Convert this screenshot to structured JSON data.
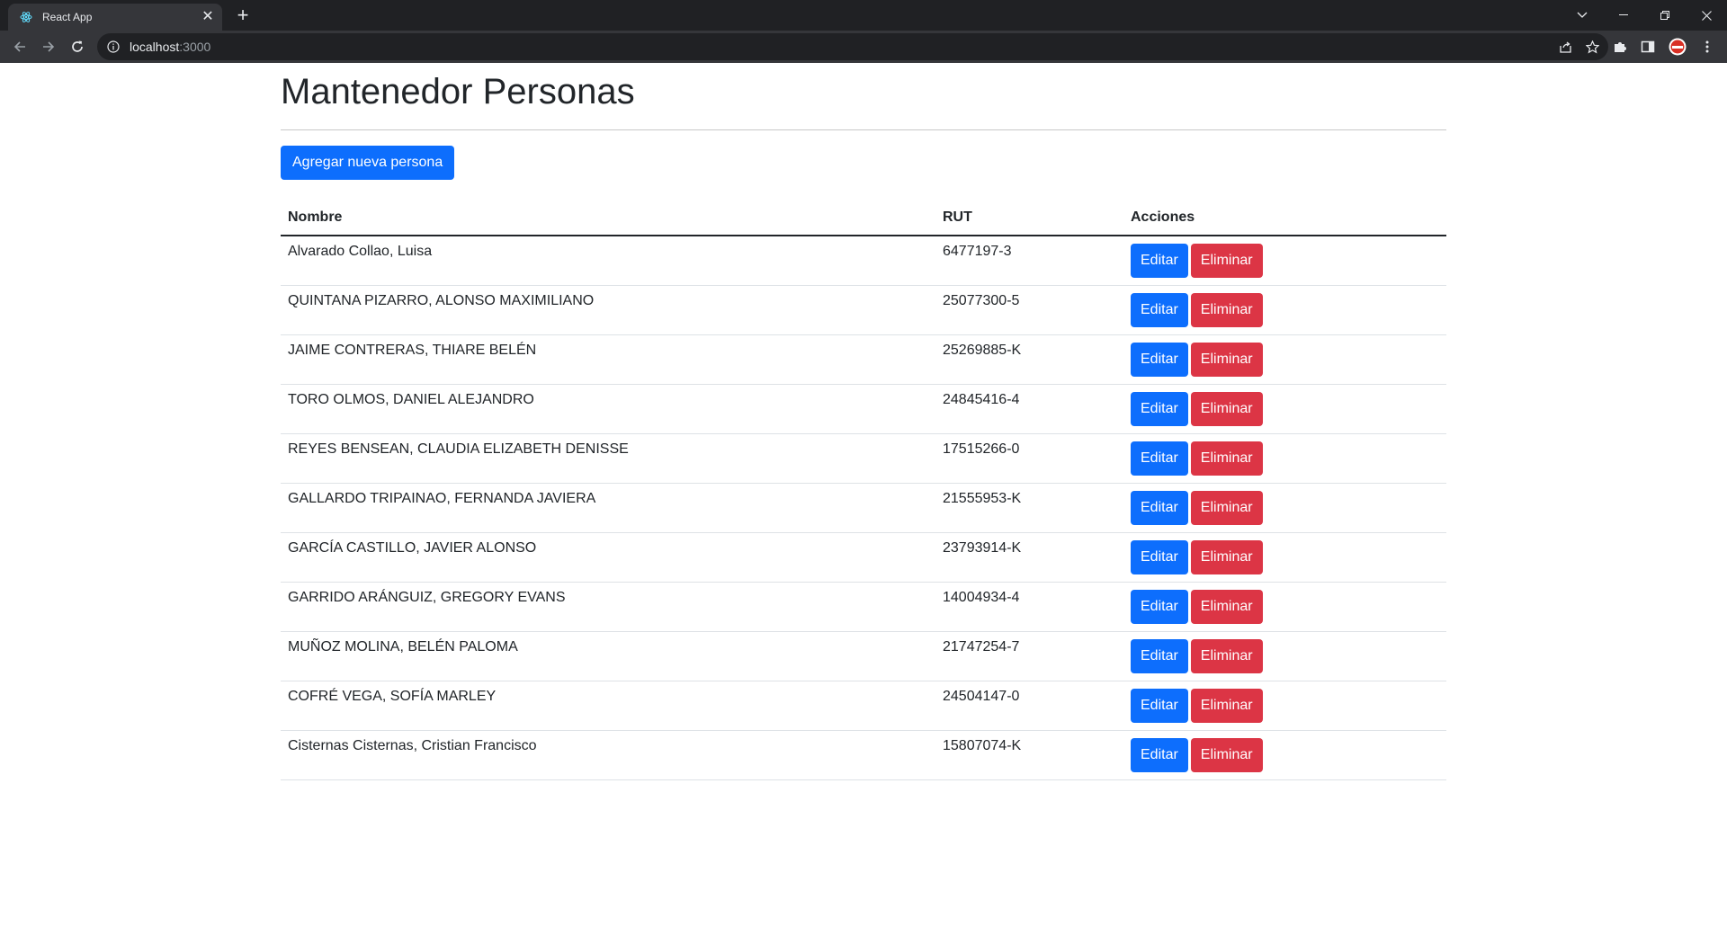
{
  "browser": {
    "tab_title": "React App",
    "url_host": "localhost",
    "url_port": ":3000"
  },
  "page": {
    "title": "Mantenedor Personas",
    "add_button_label": "Agregar nueva persona"
  },
  "table": {
    "columns": [
      "Nombre",
      "RUT",
      "Acciones"
    ],
    "edit_label": "Editar",
    "delete_label": "Eliminar",
    "rows": [
      {
        "nombre": "Alvarado Collao, Luisa",
        "rut": "6477197-3"
      },
      {
        "nombre": "QUINTANA PIZARRO, ALONSO MAXIMILIANO",
        "rut": "25077300-5"
      },
      {
        "nombre": "JAIME CONTRERAS, THIARE BELÉN",
        "rut": "25269885-K"
      },
      {
        "nombre": "TORO OLMOS, DANIEL ALEJANDRO",
        "rut": "24845416-4"
      },
      {
        "nombre": "REYES BENSEAN, CLAUDIA ELIZABETH DENISSE",
        "rut": "17515266-0"
      },
      {
        "nombre": "GALLARDO TRIPAINAO, FERNANDA JAVIERA",
        "rut": "21555953-K"
      },
      {
        "nombre": "GARCÍA CASTILLO, JAVIER ALONSO",
        "rut": "23793914-K"
      },
      {
        "nombre": "GARRIDO ARÁNGUIZ, GREGORY EVANS",
        "rut": "14004934-4"
      },
      {
        "nombre": "MUÑOZ MOLINA, BELÉN PALOMA",
        "rut": "21747254-7"
      },
      {
        "nombre": "COFRÉ VEGA, SOFÍA MARLEY",
        "rut": "24504147-0"
      },
      {
        "nombre": "Cisternas Cisternas, Cristian Francisco",
        "rut": "15807074-K"
      }
    ]
  },
  "colors": {
    "primary": "#0d6efd",
    "danger": "#dc3545",
    "chrome_dark": "#202124",
    "chrome_toolbar": "#35363a"
  }
}
